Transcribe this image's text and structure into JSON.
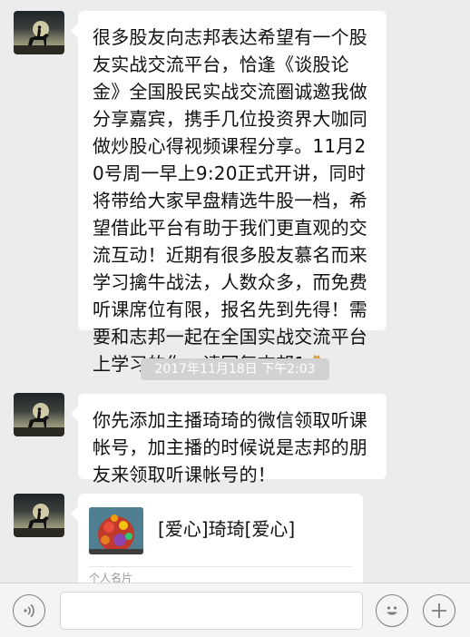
{
  "messages": [
    {
      "text": "很多股友向志邦表达希望有一个股友实战交流平台，恰逢《谈股论金》全国股民实战交流圈诚邀我做分享嘉宾，携手几位投资界大咖同做炒股心得视频课程分享。11月20号周一早上9:20正式开讲，同时将带给大家早盘精选牛股一档，希望借此平台有助于我们更直观的交流互动！近期有很多股友慕名而来学习擒牛战法，人数众多，而免费听课席位有限，报名先到先得！需要和志邦一起在全国实战交流平台上学习的你，请回复志邦1",
      "emoji": "folded-hands-emoji"
    },
    {
      "text": "你先添加主播琦琦的微信领取听课帐号，加主播的时候说是志邦的朋友来领取听课帐号的！"
    }
  ],
  "timestamp": "2017年11月18日 下午2:03",
  "contact_card": {
    "name": "[爱心]琦琦[爱心]",
    "type_label": "个人名片"
  },
  "input_bar": {
    "voice_icon": "voice-icon",
    "emoji_icon": "smiley-icon",
    "more_icon": "plus-icon"
  }
}
